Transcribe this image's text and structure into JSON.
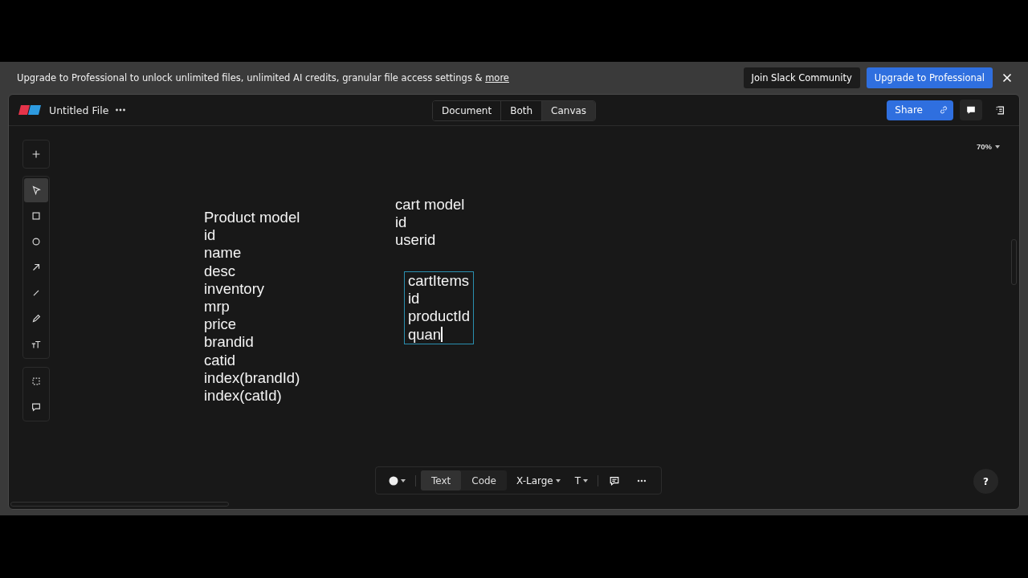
{
  "banner": {
    "message": "Upgrade to Professional to unlock unlimited files, unlimited AI credits, granular file access settings & ",
    "link": "more",
    "buttons": [
      {
        "label": "Join Slack Community",
        "kind": "secondary"
      },
      {
        "label": "Upgrade to Professional",
        "kind": "primary"
      }
    ]
  },
  "header": {
    "file_name": "Untitled File",
    "view_tabs": [
      {
        "label": "Document",
        "selected": false
      },
      {
        "label": "Both",
        "selected": false
      },
      {
        "label": "Canvas",
        "selected": true
      }
    ],
    "share": "Share"
  },
  "tools": [
    {
      "kind": "plus",
      "selected": false
    },
    {
      "kind": "pointer",
      "selected": true
    },
    {
      "kind": "square",
      "selected": false
    },
    {
      "kind": "circle",
      "selected": false
    },
    {
      "kind": "arrow",
      "selected": false
    },
    {
      "kind": "line",
      "selected": false
    },
    {
      "kind": "pencil",
      "selected": false
    },
    {
      "kind": "text",
      "selected": false
    },
    {
      "kind": "frame",
      "selected": false
    },
    {
      "kind": "comment",
      "selected": false
    }
  ],
  "zoom": "70%",
  "canvas_texts": [
    {
      "text": "Product model\nid\nname\ndesc\ninventory\nmrp\nprice\nbrandid\ncatid\nindex(brandId)\nindex(catId)",
      "editing": false
    },
    {
      "text": "cart model\nid\nuserid",
      "editing": false
    },
    {
      "text": "cartItems\nid\nproductId\nquan",
      "editing": true
    }
  ],
  "format_bar": {
    "modes": [
      {
        "label": "Text",
        "selected": true
      },
      {
        "label": "Code",
        "selected": false
      }
    ],
    "size": "X-Large",
    "font": "T"
  },
  "help": "?"
}
